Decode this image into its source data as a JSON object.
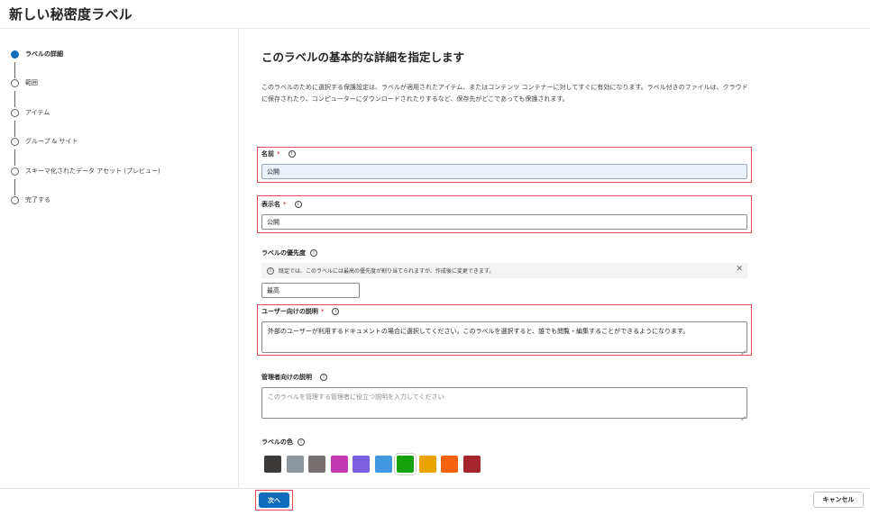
{
  "page_title": "新しい秘密度ラベル",
  "steps": [
    {
      "label": "ラベルの詳細",
      "state": "current"
    },
    {
      "label": "範囲",
      "state": "upcoming"
    },
    {
      "label": "アイテム",
      "state": "upcoming"
    },
    {
      "label": "グループ & サイト",
      "state": "upcoming"
    },
    {
      "label": "スキーマ化されたデータ アセット (プレビュー)",
      "state": "upcoming"
    },
    {
      "label": "完了する",
      "state": "upcoming"
    }
  ],
  "main": {
    "heading": "このラベルの基本的な詳細を指定します",
    "description": "このラベルのために選択する保護設定は、ラベルが適用されたアイテム、またはコンテンツ コンテナーに対してすぐに有効になります。ラベル付きのファイルは、クラウドに保存されたり、コンピューターにダウンロードされたりするなど、保存先がどこであっても保護されます。"
  },
  "fields": {
    "name": {
      "label": "名前",
      "required": "*",
      "value": "公開"
    },
    "display_name": {
      "label": "表示名",
      "required": "*",
      "value": "公開"
    },
    "priority": {
      "label": "ラベルの優先度",
      "info_text": "既定では、このラベルには最高の優先度が割り当てられますが、作成後に変更できます。",
      "value": "最高"
    },
    "user_description": {
      "label": "ユーザー向けの説明",
      "required": "*",
      "value": "外部のユーザーが利用するドキュメントの場合に選択してください。このラベルを選択すると、誰でも閲覧・編集することができるようになります。"
    },
    "admin_description": {
      "label": "管理者向けの説明",
      "placeholder": "このラベルを管理する管理者に役立つ説明を入力してください"
    },
    "color": {
      "label": "ラベルの色",
      "selected_index": 6,
      "swatches": [
        "#3b3a39",
        "#8e979d",
        "#767170",
        "#c239b3",
        "#7b61e0",
        "#4299e1",
        "#13a10e",
        "#eaa300",
        "#f7630c",
        "#a4262c"
      ]
    }
  },
  "footer": {
    "next_label": "次へ",
    "cancel_label": "キャンセル"
  },
  "icons": {
    "info": "info-icon",
    "close": "close-icon"
  }
}
